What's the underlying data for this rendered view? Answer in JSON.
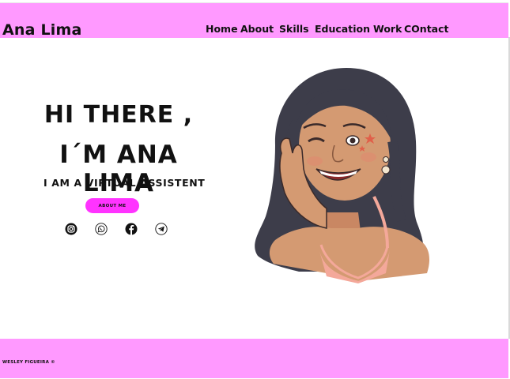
{
  "header": {
    "logo": "Ana Lima",
    "nav": [
      "Home",
      "About",
      "Skills",
      "Education",
      "Work",
      "COntact"
    ]
  },
  "hero": {
    "greeting_line1": "HI THERE ,",
    "greeting_line2": "I´M ANA LIMA",
    "subtitle": "I AM  A VIRTUAL ASSISTENT",
    "button_label": "ABOUT ME"
  },
  "social_icons": [
    "instagram-icon",
    "whatsapp-icon",
    "facebook-icon",
    "telegram-icon"
  ],
  "footer": {
    "credit": "WESLEY FIGUEIRA ©"
  },
  "colors": {
    "header_bg": "#ff99ff",
    "button_bg": "#ff33ff",
    "footer_bg": "#ff99ff"
  }
}
